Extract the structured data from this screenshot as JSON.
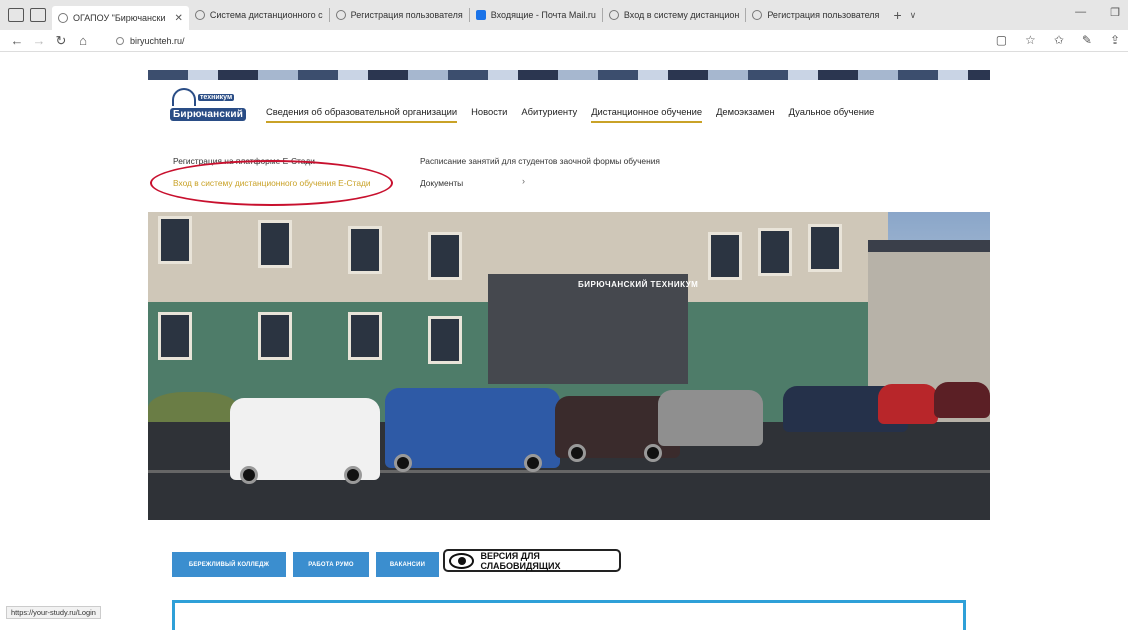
{
  "browser": {
    "tabs": [
      {
        "title": "ОГАПОУ \"Бирючански",
        "active": true
      },
      {
        "title": "Система дистанционного с",
        "active": false
      },
      {
        "title": "Регистрация пользователя",
        "active": false
      },
      {
        "title": "Входящие - Почта Mail.ru",
        "active": false
      },
      {
        "title": "Вход в систему дистанцион",
        "active": false
      },
      {
        "title": "Регистрация пользователя",
        "active": false
      }
    ],
    "new_tab": "+",
    "tab_list": "∨",
    "url": "biryuchteh.ru/",
    "status_url": "https://your-study.ru/Login"
  },
  "site": {
    "logo_top": "техникум",
    "logo_name": "Бирючанский",
    "menu": [
      "Сведения об образовательной организации",
      "Новости",
      "Абитуриенту",
      "Дистанционное обучение",
      "Демоэкзамен",
      "Дуальное обучение"
    ],
    "dropdown": {
      "left": [
        "Регистрация на платформе Е-Стади",
        "Вход в систему дистанционного обучения Е-Стади"
      ],
      "right": [
        "Расписание занятий для студентов заочной формы обучения",
        "Документы"
      ],
      "chevron": "›"
    },
    "photo_sign": "БИРЮЧАНСКИЙ ТЕХНИКУМ",
    "buttons": [
      "БЕРЕЖЛИВЫЙ КОЛЛЕДЖ",
      "РАБОТА РУМО",
      "ВАКАНСИИ"
    ],
    "vision_label": "ВЕРСИЯ ДЛЯ СЛАБОВИДЯЩИХ"
  },
  "colors": {
    "accent": "#c9a227",
    "button": "#3b8ecf",
    "highlight_ring": "#c8102e"
  }
}
